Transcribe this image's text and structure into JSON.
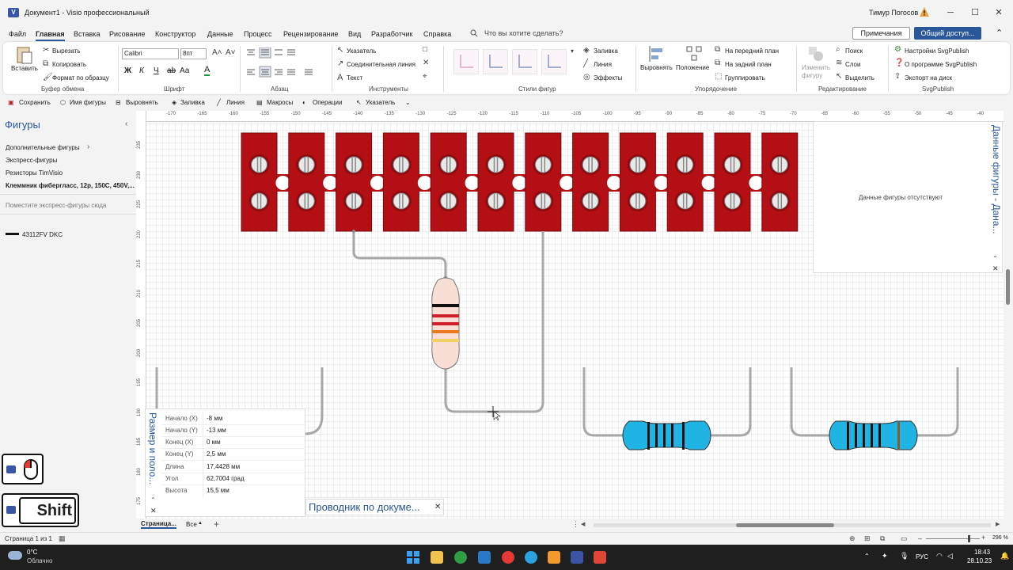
{
  "titlebar": {
    "doc_title": "Документ1  -  Visio профессиональный",
    "user": "Тимур Погосов",
    "minimize": "─",
    "maximize": "☐",
    "close": "✕"
  },
  "menu": {
    "tabs": [
      "Файл",
      "Главная",
      "Вставка",
      "Рисование",
      "Конструктор",
      "Данные",
      "Процесс",
      "Рецензирование",
      "Вид",
      "Разработчик",
      "Справка"
    ],
    "active": "Главная",
    "tell_me": "Что вы хотите сделать?",
    "comments": "Примечания",
    "share": "Общий доступ..."
  },
  "ribbon": {
    "clipboard": {
      "paste": "Вставить",
      "cut": "Вырезать",
      "copy": "Копировать",
      "format_painter": "Формат по образцу",
      "label": "Буфер обмена"
    },
    "font": {
      "name": "Calibri",
      "size": "8пт",
      "label": "Шрифт",
      "bold": "Ж",
      "italic": "К",
      "underline": "Ч",
      "strike": "аb",
      "case": "Аа",
      "color": "А"
    },
    "paragraph": {
      "label": "Абзац"
    },
    "tools": {
      "pointer": "Указатель",
      "connector": "Соединительная линия",
      "text": "Текст",
      "label": "Инструменты"
    },
    "shape_styles": {
      "fill": "Заливка",
      "line": "Линия",
      "effects": "Эффекты",
      "label": "Стили фигур"
    },
    "arrange": {
      "align": "Выровнять",
      "position": "Положение",
      "front": "На передний план",
      "back": "На задний план",
      "group": "Группировать",
      "label": "Упорядочение"
    },
    "editing": {
      "change_shape": "Изменить фигуру",
      "find": "Поиск",
      "layers": "Слои",
      "select": "Выделить",
      "label": "Редактирование"
    },
    "svgpublish": {
      "settings": "Настройки SvgPublish",
      "about": "О программе SvgPublish",
      "export": "Экспорт на диск",
      "label": "SvgPublish"
    }
  },
  "qat": [
    "Сохранить",
    "Имя фигуры",
    "Выровнять",
    "Заливка",
    "Линия",
    "Макросы",
    "Операции",
    "Указатель"
  ],
  "shapes_panel": {
    "title": "Фигуры",
    "more": "Дополнительные фигуры",
    "quick": "Экспресс-фигуры",
    "stencil1": "Резисторы TimVisio",
    "stencil2": "Клеммник фибергласс, 12p, 150C, 450V,...",
    "hint": "Поместите экспресс-фигуры сюда",
    "item": "43112FV DKC"
  },
  "ruler": {
    "x_labels": [
      "-170",
      "-165",
      "-160",
      "-155",
      "-150",
      "-145",
      "-140",
      "-135",
      "-130",
      "-125",
      "-120",
      "-115",
      "-110",
      "-105",
      "-100",
      "-95",
      "-90",
      "-85",
      "-80",
      "-75",
      "-70",
      "-65",
      "-60",
      "-55",
      "-50",
      "-45",
      "-40"
    ],
    "y_labels": [
      "235",
      "230",
      "225",
      "220",
      "215",
      "210",
      "205",
      "200",
      "195",
      "190",
      "185",
      "180",
      "175"
    ]
  },
  "data_panel": {
    "title": "Данные фигуры - Дана...",
    "empty_message": "Данные фигуры отсутствуют"
  },
  "size_panel": {
    "title": "Размер и поло...",
    "rows": [
      {
        "label": "Начало (X)",
        "value": "-8 мм"
      },
      {
        "label": "Начало (Y)",
        "value": "-13 мм"
      },
      {
        "label": "Конец (X)",
        "value": "0 мм"
      },
      {
        "label": "Конец (Y)",
        "value": "2,5 мм"
      },
      {
        "label": "Длина",
        "value": "17,4428 мм"
      },
      {
        "label": "Угол",
        "value": "62,7004 град"
      },
      {
        "label": "Высота",
        "value": "15,5 мм"
      }
    ]
  },
  "navigator": {
    "title": "Проводник по докуме..."
  },
  "key_overlay": {
    "shift": "Shift"
  },
  "pagetabs": {
    "page": "Страница...",
    "all": "Все",
    "add": "+"
  },
  "status": {
    "page": "Страница 1 из 1",
    "zoom": "296 %"
  },
  "taskbar": {
    "temp": "0°C",
    "weather": "Облачно",
    "lang": "РУС",
    "time": "18:43",
    "date": "28.10.23"
  },
  "colors": {
    "terminal_red": "#b30f14",
    "resistor_beige": "#f8ded5",
    "resistor_blue": "#1fb4e3",
    "wire": "#a0a0a0",
    "accent": "#2b579a"
  }
}
